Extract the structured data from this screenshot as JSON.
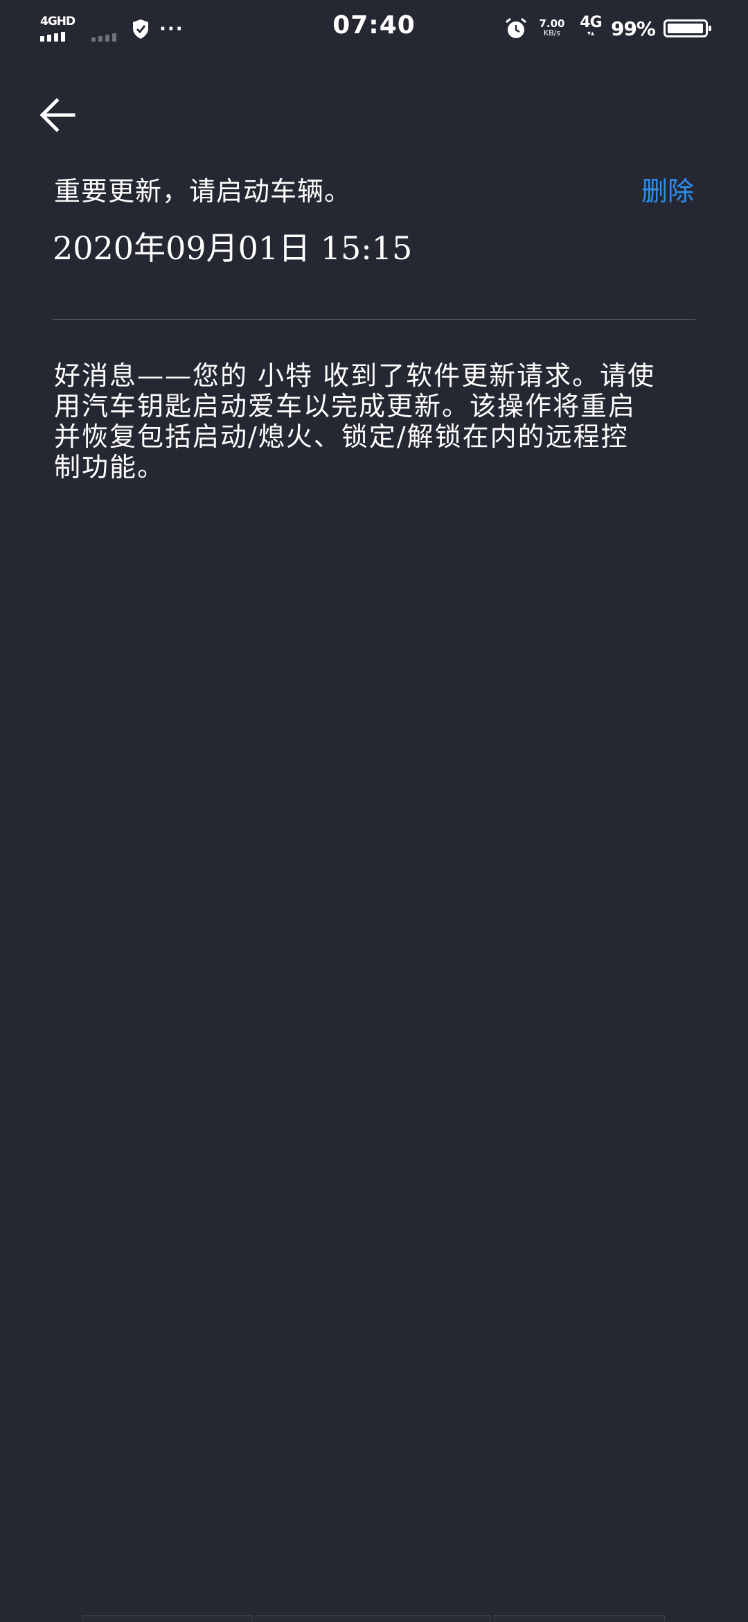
{
  "status_bar": {
    "network1": "4GHD",
    "time": "07:40",
    "speed_value": "7.00",
    "speed_unit": "KB/s",
    "network2": "4G",
    "network2_sub": "1",
    "battery_percent": "99%",
    "battery_level": 0.99,
    "more": "···"
  },
  "header": {
    "back_icon": "arrow-left-icon"
  },
  "message": {
    "title": "重要更新，请启动车辆。",
    "delete_label": "删除",
    "date": "2020年09月01日 15:15",
    "body": "好消息——您的 小特 收到了软件更新请求。请使\n用汽车钥匙启动爱车以完成更新。该操作将重启\n并恢复包括启动/熄火、锁定/解锁在内的远程控\n制功能。"
  },
  "colors": {
    "background": "#252832",
    "accent": "#2e8ef0",
    "divider": "#4a4d56"
  }
}
